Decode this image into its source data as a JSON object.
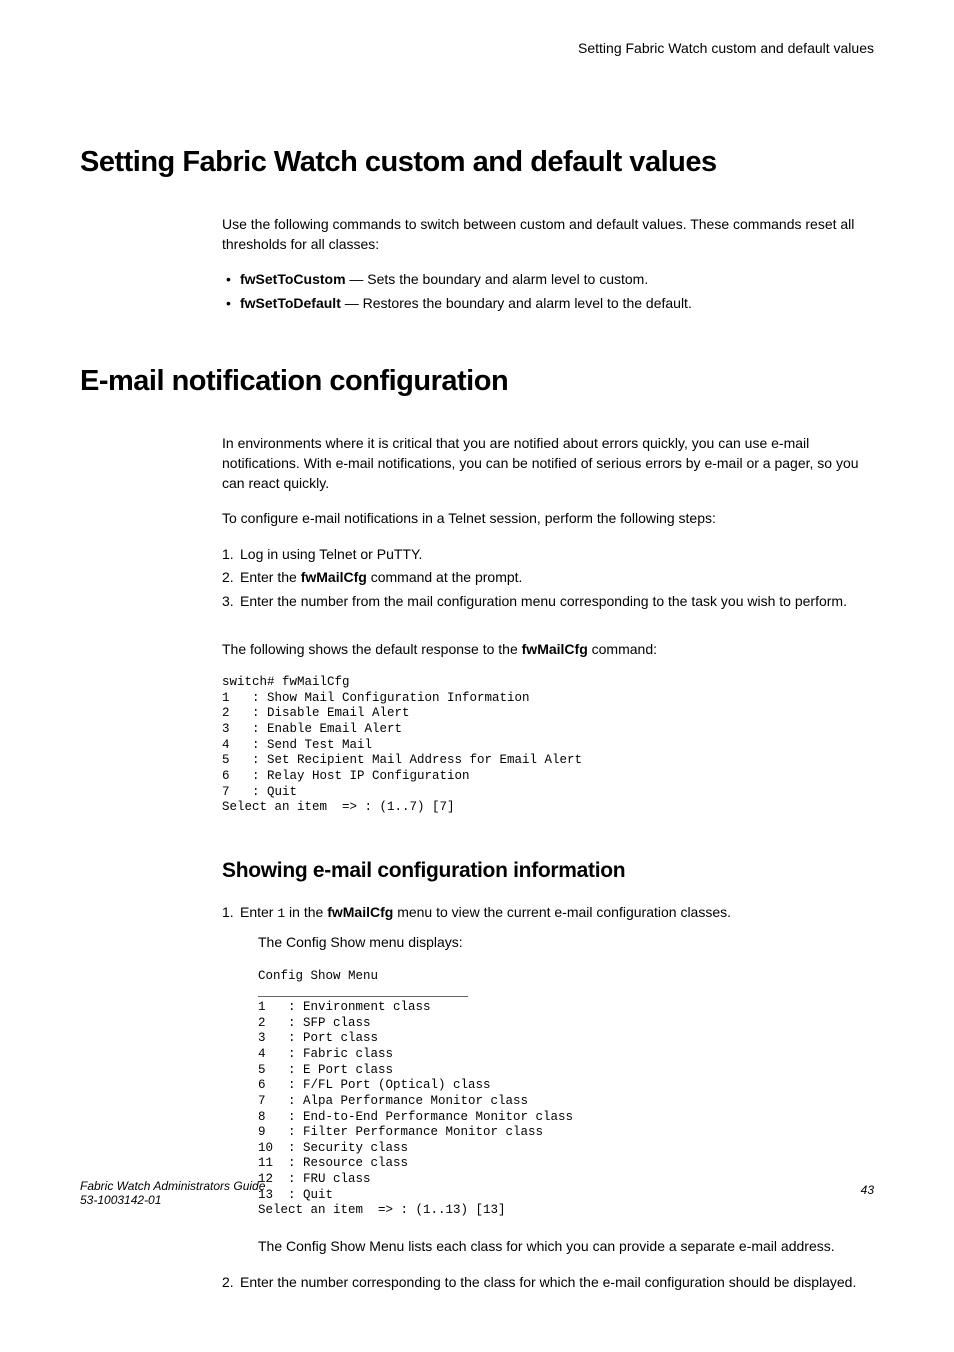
{
  "header": {
    "running_title": "Setting Fabric Watch custom and default values"
  },
  "section1": {
    "title": "Setting Fabric Watch custom and default values",
    "intro": "Use the following commands to switch between custom and default values. These commands reset all thresholds for all classes:",
    "bullets": [
      {
        "cmd": "fwSetToCustom",
        "desc": " — Sets the boundary and alarm level to custom."
      },
      {
        "cmd": "fwSetToDefault",
        "desc": " — Restores the boundary and alarm level to the default."
      }
    ]
  },
  "section2": {
    "title": "E-mail notification configuration",
    "para1": "In environments where it is critical that you are notified about errors quickly, you can use e-mail notifications. With e-mail notifications, you can be notified of serious errors by e-mail or a pager, so you can react quickly.",
    "para2": "To configure e-mail notifications in a Telnet session, perform the following steps:",
    "steps": [
      {
        "n": "1.",
        "text_pre": "Log in using Telnet or PuTTY."
      },
      {
        "n": "2.",
        "text_pre": "Enter the ",
        "cmd": "fwMailCfg",
        "text_post": " command at the prompt."
      },
      {
        "n": "3.",
        "text_pre": "Enter the number from the mail configuration menu corresponding to the task you wish to perform."
      }
    ],
    "para3_pre": "The following shows the default response to the ",
    "para3_cmd": "fwMailCfg",
    "para3_post": " command:",
    "code1": "switch# fwMailCfg\n1   : Show Mail Configuration Information\n2   : Disable Email Alert\n3   : Enable Email Alert\n4   : Send Test Mail\n5   : Set Recipient Mail Address for Email Alert\n6   : Relay Host IP Configuration\n7   : Quit\nSelect an item  => : (1..7) [7]"
  },
  "section3": {
    "title": "Showing e-mail configuration information",
    "step1_pre": "Enter ",
    "step1_code": "1",
    "step1_mid": " in the ",
    "step1_cmd": "fwMailCfg",
    "step1_post": " menu to view the current e-mail configuration classes.",
    "step1_sub": "The Config Show menu displays:",
    "code2": "Config Show Menu\n____________________________\n1   : Environment class\n2   : SFP class\n3   : Port class\n4   : Fabric class\n5   : E Port class\n6   : F/FL Port (Optical) class\n7   : Alpa Performance Monitor class\n8   : End-to-End Performance Monitor class\n9   : Filter Performance Monitor class\n10  : Security class\n11  : Resource class\n12  : FRU class\n13  : Quit\nSelect an item  => : (1..13) [13]",
    "step1_after": "The Config Show Menu lists each class for which you can provide a separate e-mail address.",
    "step2": "Enter the number corresponding to the class for which the e-mail configuration should be displayed."
  },
  "footer": {
    "title": "Fabric Watch Administrators Guide",
    "docnum": "53-1003142-01",
    "page": "43"
  }
}
